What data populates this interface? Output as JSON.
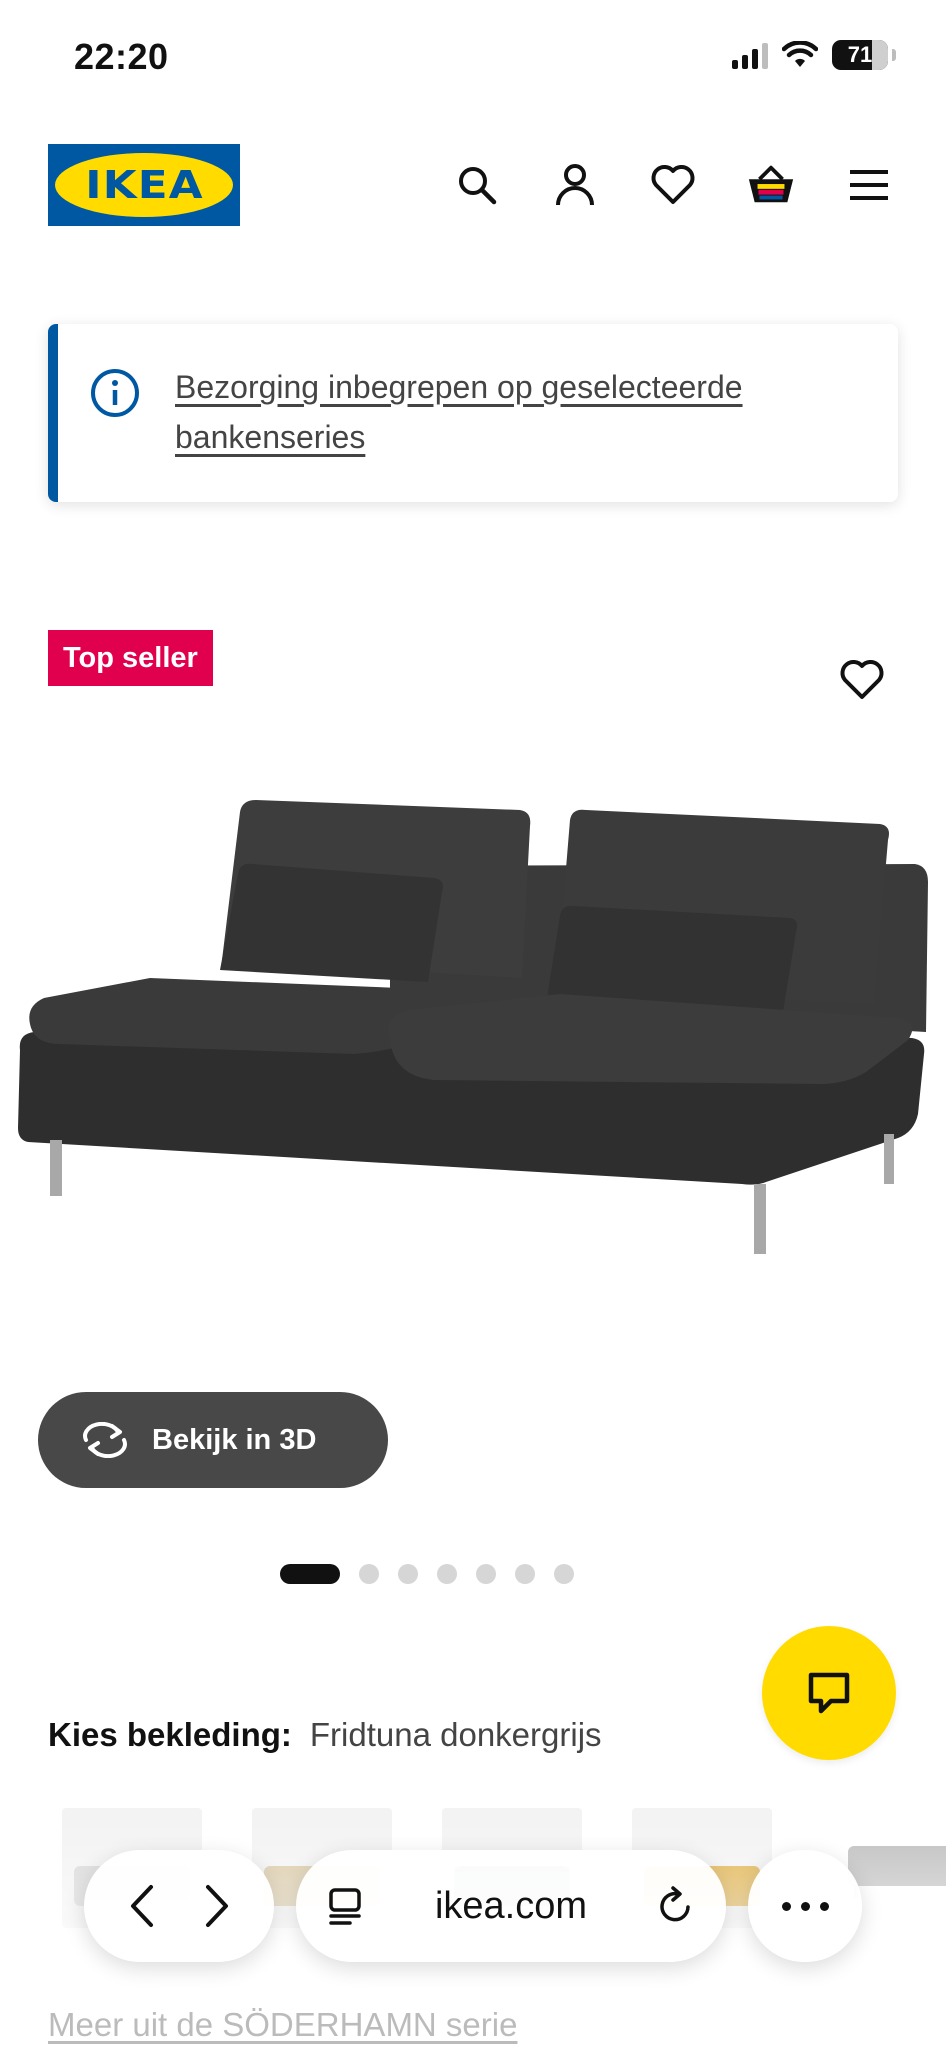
{
  "status_bar": {
    "time": "22:20",
    "battery": "71"
  },
  "header": {
    "logo_text": "IKEA",
    "icons": [
      "search-icon",
      "account-icon",
      "heart-icon",
      "basket-icon",
      "menu-icon"
    ]
  },
  "banner": {
    "text": "Bezorging inbegrepen op geselecteerde bankenseries"
  },
  "product": {
    "badge": "Top seller",
    "view_3d_label": "Bekijk in 3D",
    "image_count": 7,
    "active_image": 1
  },
  "upholstery": {
    "label": "Kies bekleding:",
    "value": "Fridtuna donkergrijs"
  },
  "browser": {
    "url": "ikea.com"
  },
  "series_link": "Meer uit de SÖDERHAMN serie",
  "colors": {
    "ikea_blue": "#0058a3",
    "ikea_yellow": "#ffdb00",
    "badge_red": "#e0004d"
  }
}
